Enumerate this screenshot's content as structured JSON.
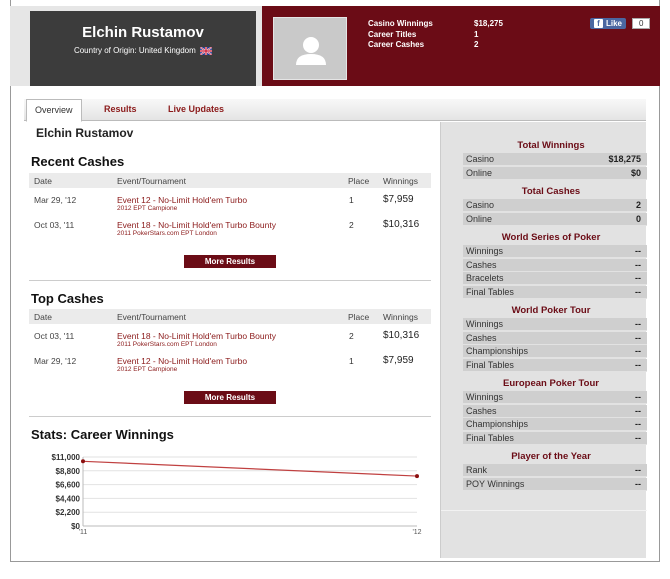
{
  "player": {
    "name": "Elchin Rustamov",
    "origin": "Country of Origin: United Kingdom"
  },
  "header_stats": [
    {
      "label": "Casino Winnings",
      "value": "$18,275"
    },
    {
      "label": "Career Titles",
      "value": "1"
    },
    {
      "label": "Career Cashes",
      "value": "2"
    }
  ],
  "facebook": {
    "like_label": "Like",
    "count": "0"
  },
  "tabs": [
    {
      "label": "Overview"
    },
    {
      "label": "Results"
    },
    {
      "label": "Live Updates"
    }
  ],
  "main_title": "Elchin Rustamov",
  "recent_cashes": {
    "title": "Recent Cashes",
    "headers": {
      "date": "Date",
      "event": "Event/Tournament",
      "place": "Place",
      "winnings": "Winnings"
    },
    "rows": [
      {
        "date": "Mar 29, '12",
        "event": "Event 12 - No-Limit Hold'em Turbo",
        "sub": "2012 EPT Campione",
        "place": "1",
        "winnings": "$7,959"
      },
      {
        "date": "Oct 03, '11",
        "event": "Event 18 - No-Limit Hold'em Turbo Bounty",
        "sub": "2011 PokerStars.com EPT London",
        "place": "2",
        "winnings": "$10,316"
      }
    ],
    "more_label": "More Results"
  },
  "top_cashes": {
    "title": "Top Cashes",
    "headers": {
      "date": "Date",
      "event": "Event/Tournament",
      "place": "Place",
      "winnings": "Winnings"
    },
    "rows": [
      {
        "date": "Oct 03, '11",
        "event": "Event 18 - No-Limit Hold'em Turbo Bounty",
        "sub": "2011 PokerStars.com EPT London",
        "place": "2",
        "winnings": "$10,316"
      },
      {
        "date": "Mar 29, '12",
        "event": "Event 12 - No-Limit Hold'em Turbo",
        "sub": "2012 EPT Campione",
        "place": "1",
        "winnings": "$7,959"
      }
    ],
    "more_label": "More Results"
  },
  "stats_title": "Stats: Career Winnings",
  "chart_data": {
    "type": "line",
    "x": [
      "'11",
      "'12"
    ],
    "series": [
      {
        "values": [
          10316,
          7959
        ]
      }
    ],
    "yticks": [
      "$11,000",
      "$8,800",
      "$6,600",
      "$4,400",
      "$2,200",
      "$0"
    ],
    "ytick_values": [
      11000,
      8800,
      6600,
      4400,
      2200,
      0
    ],
    "ylim": [
      0,
      11000
    ],
    "line_color": "#c04040",
    "grid": true
  },
  "sidebar": [
    {
      "title": "Total Winnings",
      "rows": [
        {
          "k": "Casino",
          "v": "$18,275"
        },
        {
          "k": "Online",
          "v": "$0"
        }
      ]
    },
    {
      "title": "Total Cashes",
      "rows": [
        {
          "k": "Casino",
          "v": "2"
        },
        {
          "k": "Online",
          "v": "0"
        }
      ]
    },
    {
      "title": "World Series of Poker",
      "rows": [
        {
          "k": "Winnings",
          "v": "--"
        },
        {
          "k": "Cashes",
          "v": "--"
        },
        {
          "k": "Bracelets",
          "v": "--"
        },
        {
          "k": "Final Tables",
          "v": "--"
        }
      ]
    },
    {
      "title": "World Poker Tour",
      "rows": [
        {
          "k": "Winnings",
          "v": "--"
        },
        {
          "k": "Cashes",
          "v": "--"
        },
        {
          "k": "Championships",
          "v": "--"
        },
        {
          "k": "Final Tables",
          "v": "--"
        }
      ]
    },
    {
      "title": "European Poker Tour",
      "rows": [
        {
          "k": "Winnings",
          "v": "--"
        },
        {
          "k": "Cashes",
          "v": "--"
        },
        {
          "k": "Championships",
          "v": "--"
        },
        {
          "k": "Final Tables",
          "v": "--"
        }
      ]
    },
    {
      "title": "Player of the Year",
      "rows": [
        {
          "k": "Rank",
          "v": "--"
        },
        {
          "k": "POY Winnings",
          "v": "--"
        }
      ]
    }
  ],
  "colors": {
    "maroon": "#6b0c16",
    "dark": "#3c3c3c",
    "link": "#8b1a1a"
  }
}
